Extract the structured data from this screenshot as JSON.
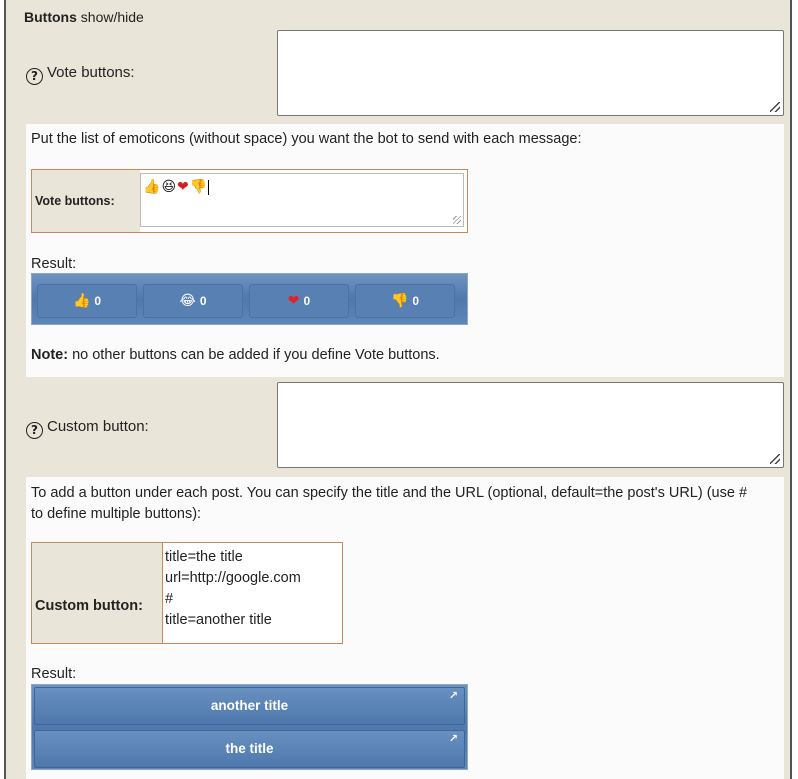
{
  "section": {
    "title_bold": "Buttons",
    "title_rest": " show/hide"
  },
  "vote_field": {
    "help_icon": "question-circle-icon",
    "label": "Vote buttons:",
    "value": ""
  },
  "vote_panel": {
    "description": "Put the list of emoticons (without space) you want the bot to send with each message:",
    "example_label": "Vote buttons:",
    "example_emojis": [
      "👍",
      "😆",
      "❤",
      "👎"
    ],
    "result_label": "Result:",
    "result_buttons": [
      {
        "emoji": "👍",
        "count": "0"
      },
      {
        "emoji": "😂",
        "count": "0"
      },
      {
        "emoji": "❤",
        "count": "0"
      },
      {
        "emoji": "👎",
        "count": "0"
      }
    ],
    "note_bold": "Note:",
    "note_rest": " no other buttons can be added if you define Vote buttons."
  },
  "custom_field": {
    "help_icon": "question-circle-icon",
    "label": "Custom button:",
    "value": ""
  },
  "custom_panel": {
    "description_line1": "To add a button under each post. You can specify the title and the URL (optional, default=the post's URL) (use #",
    "description_line2": "to define multiple buttons):",
    "example_label": "Custom button:",
    "example_lines": [
      "title=the title",
      "url=http://google.com",
      "#",
      "title=another title"
    ],
    "result_label": "Result:",
    "result_buttons": [
      {
        "title": "another title",
        "icon": "external-link-icon"
      },
      {
        "title": "the title",
        "icon": "external-link-icon"
      }
    ]
  },
  "colors": {
    "page_bg": "#e9e5d8",
    "panel_bg": "#fcfbfb",
    "table_border": "#c88a5a",
    "button_blue": "#5880b3"
  }
}
